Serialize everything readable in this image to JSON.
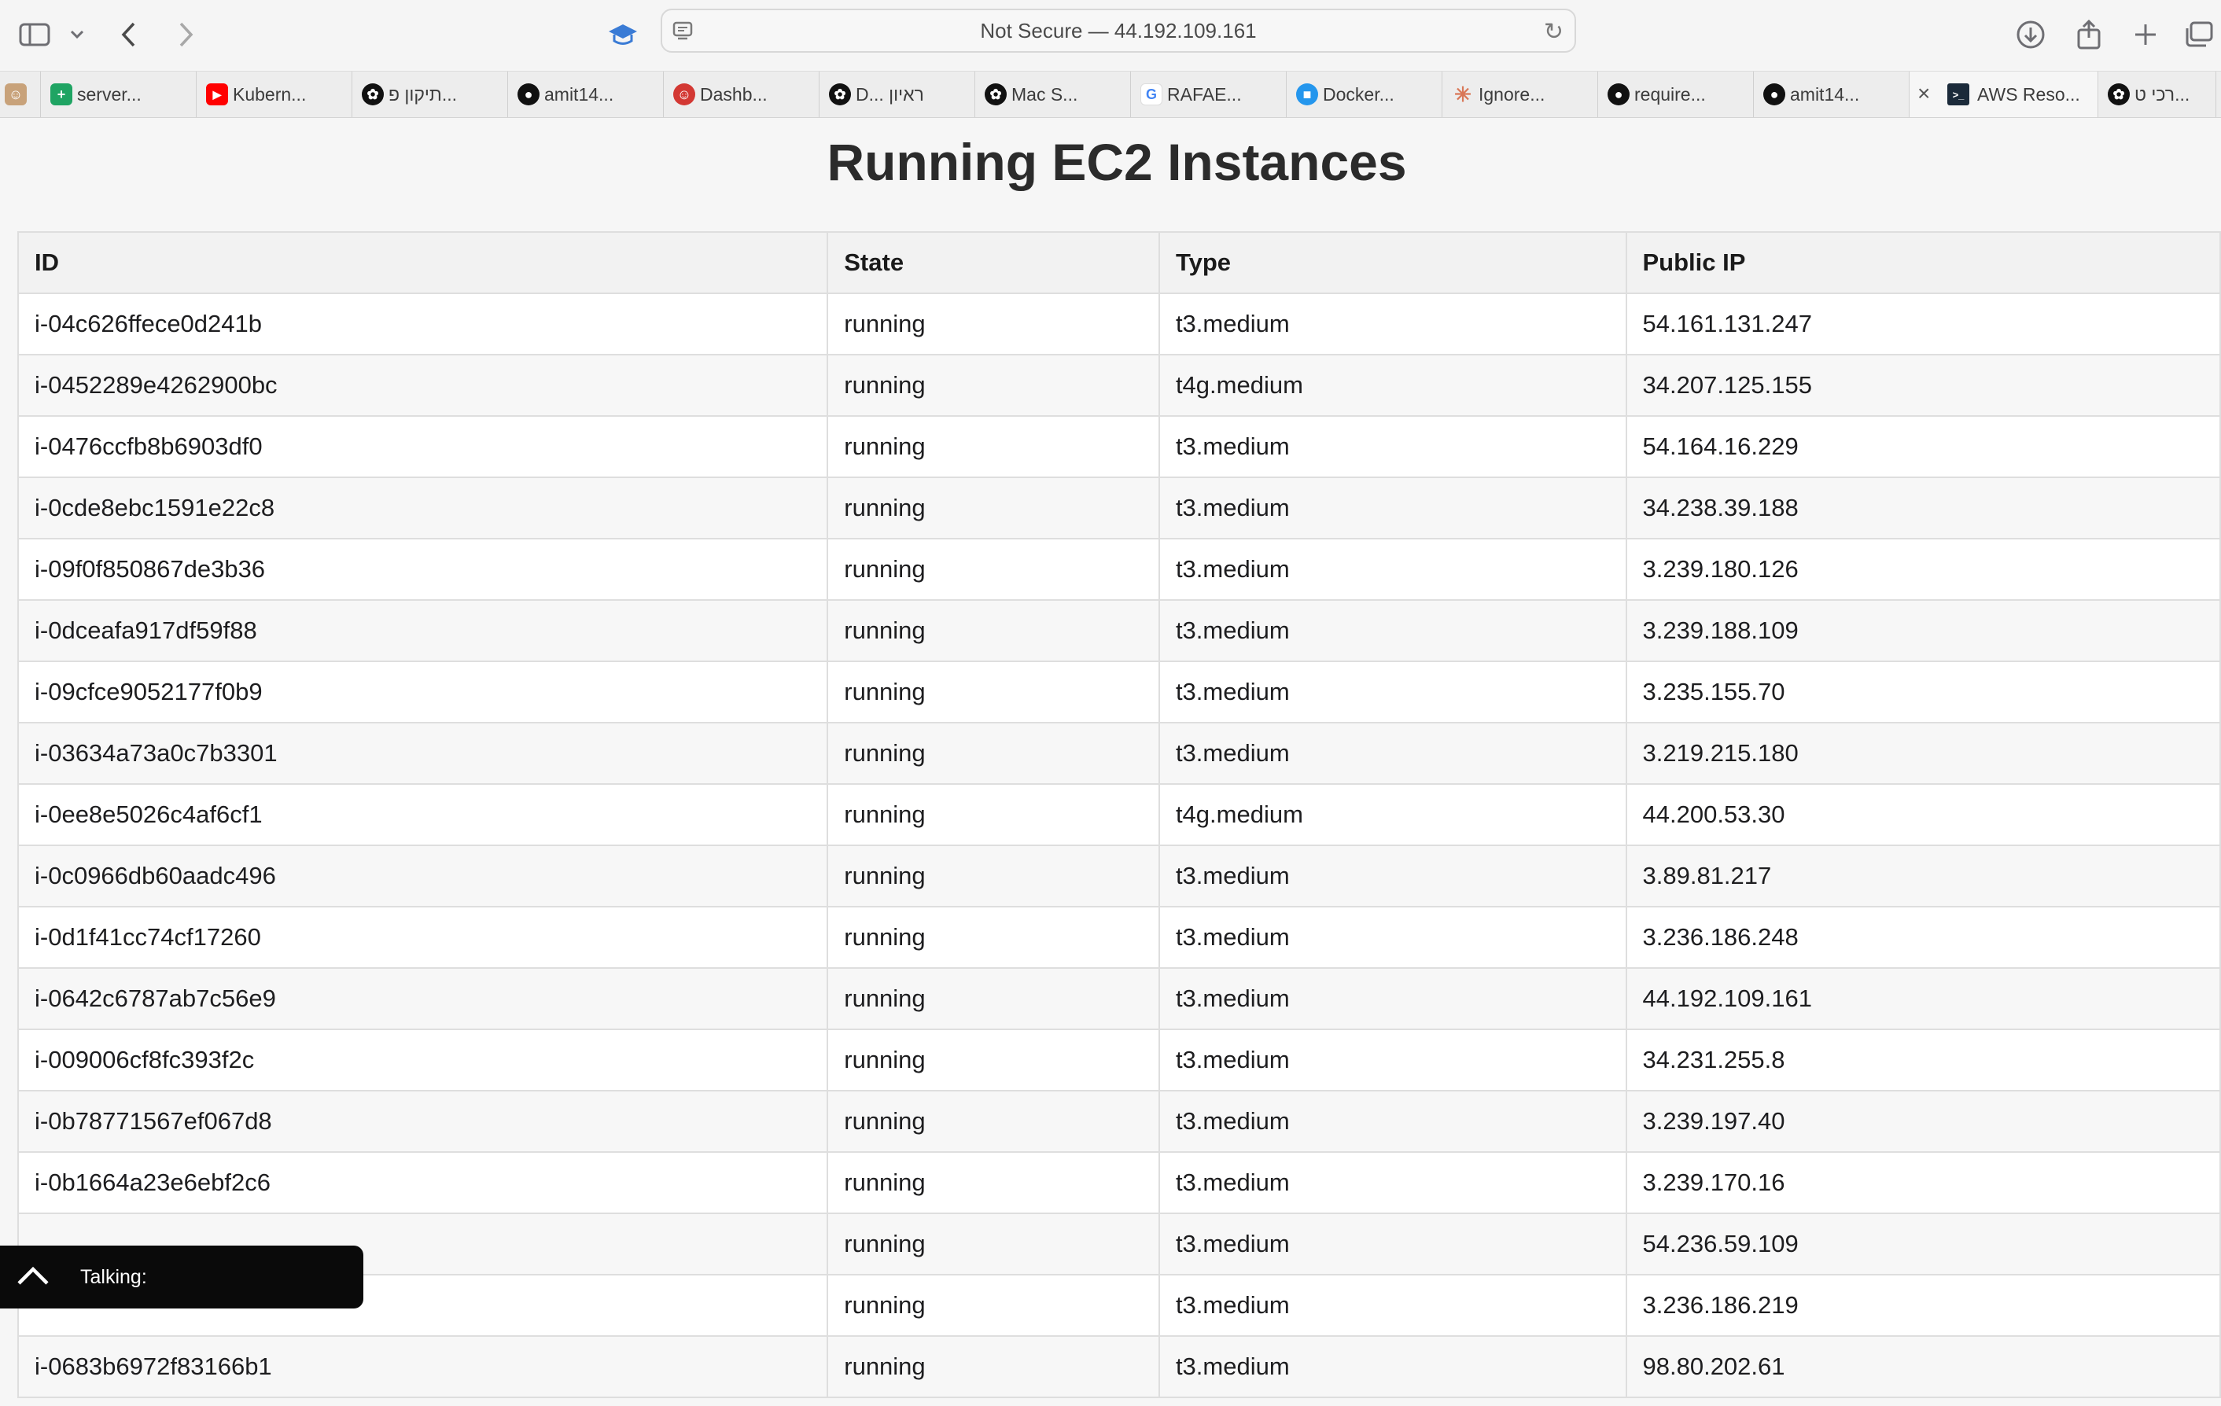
{
  "browser": {
    "address": "Not Secure — 44.192.109.161",
    "tabs": [
      {
        "label": "",
        "favicon": "avatar-icon",
        "color": "#c8a27a"
      },
      {
        "label": "server...",
        "favicon": "sheets-icon",
        "color": "#1fa463"
      },
      {
        "label": "Kubern...",
        "favicon": "youtube-icon",
        "color": "#ff0000"
      },
      {
        "label": "תיקון פ...",
        "favicon": "openai-icon",
        "color": "#111111"
      },
      {
        "label": "amit14...",
        "favicon": "github-icon",
        "color": "#111111"
      },
      {
        "label": "Dashb...",
        "favicon": "jenkins-icon",
        "color": "#d33833"
      },
      {
        "label": "D... ראיון",
        "favicon": "openai-icon",
        "color": "#111111"
      },
      {
        "label": "Mac S...",
        "favicon": "openai-icon",
        "color": "#111111"
      },
      {
        "label": "RAFAE...",
        "favicon": "google-icon",
        "color": "#4285f4"
      },
      {
        "label": "Docker...",
        "favicon": "docker-icon",
        "color": "#2496ed"
      },
      {
        "label": "Ignore...",
        "favicon": "claude-icon",
        "color": "#d97757"
      },
      {
        "label": "require...",
        "favicon": "github-icon",
        "color": "#111111"
      },
      {
        "label": "amit14...",
        "favicon": "github-icon",
        "color": "#111111"
      },
      {
        "label": "AWS Reso...",
        "favicon": "terminal-icon",
        "color": "#1b2a3a"
      },
      {
        "label": "רכי ט...",
        "favicon": "openai-icon",
        "color": "#111111"
      }
    ]
  },
  "page": {
    "title": "Running EC2 Instances",
    "columns": [
      "ID",
      "State",
      "Type",
      "Public IP"
    ],
    "rows": [
      [
        "i-04c626ffece0d241b",
        "running",
        "t3.medium",
        "54.161.131.247"
      ],
      [
        "i-0452289e4262900bc",
        "running",
        "t4g.medium",
        "34.207.125.155"
      ],
      [
        "i-0476ccfb8b6903df0",
        "running",
        "t3.medium",
        "54.164.16.229"
      ],
      [
        "i-0cde8ebc1591e22c8",
        "running",
        "t3.medium",
        "34.238.39.188"
      ],
      [
        "i-09f0f850867de3b36",
        "running",
        "t3.medium",
        "3.239.180.126"
      ],
      [
        "i-0dceafa917df59f88",
        "running",
        "t3.medium",
        "3.239.188.109"
      ],
      [
        "i-09cfce9052177f0b9",
        "running",
        "t3.medium",
        "3.235.155.70"
      ],
      [
        "i-03634a73a0c7b3301",
        "running",
        "t3.medium",
        "3.219.215.180"
      ],
      [
        "i-0ee8e5026c4af6cf1",
        "running",
        "t4g.medium",
        "44.200.53.30"
      ],
      [
        "i-0c0966db60aadc496",
        "running",
        "t3.medium",
        "3.89.81.217"
      ],
      [
        "i-0d1f41cc74cf17260",
        "running",
        "t3.medium",
        "3.236.186.248"
      ],
      [
        "i-0642c6787ab7c56e9",
        "running",
        "t3.medium",
        "44.192.109.161"
      ],
      [
        "i-009006cf8fc393f2c",
        "running",
        "t3.medium",
        "34.231.255.8"
      ],
      [
        "i-0b78771567ef067d8",
        "running",
        "t3.medium",
        "3.239.197.40"
      ],
      [
        "i-0b1664a23e6ebf2c6",
        "running",
        "t3.medium",
        "3.239.170.16"
      ],
      [
        "",
        "running",
        "t3.medium",
        "54.236.59.109"
      ],
      [
        "",
        "running",
        "t3.medium",
        "3.236.186.219"
      ],
      [
        "i-0683b6972f83166b1",
        "running",
        "t3.medium",
        "98.80.202.61"
      ]
    ]
  },
  "overlay": {
    "label": "Talking:"
  }
}
